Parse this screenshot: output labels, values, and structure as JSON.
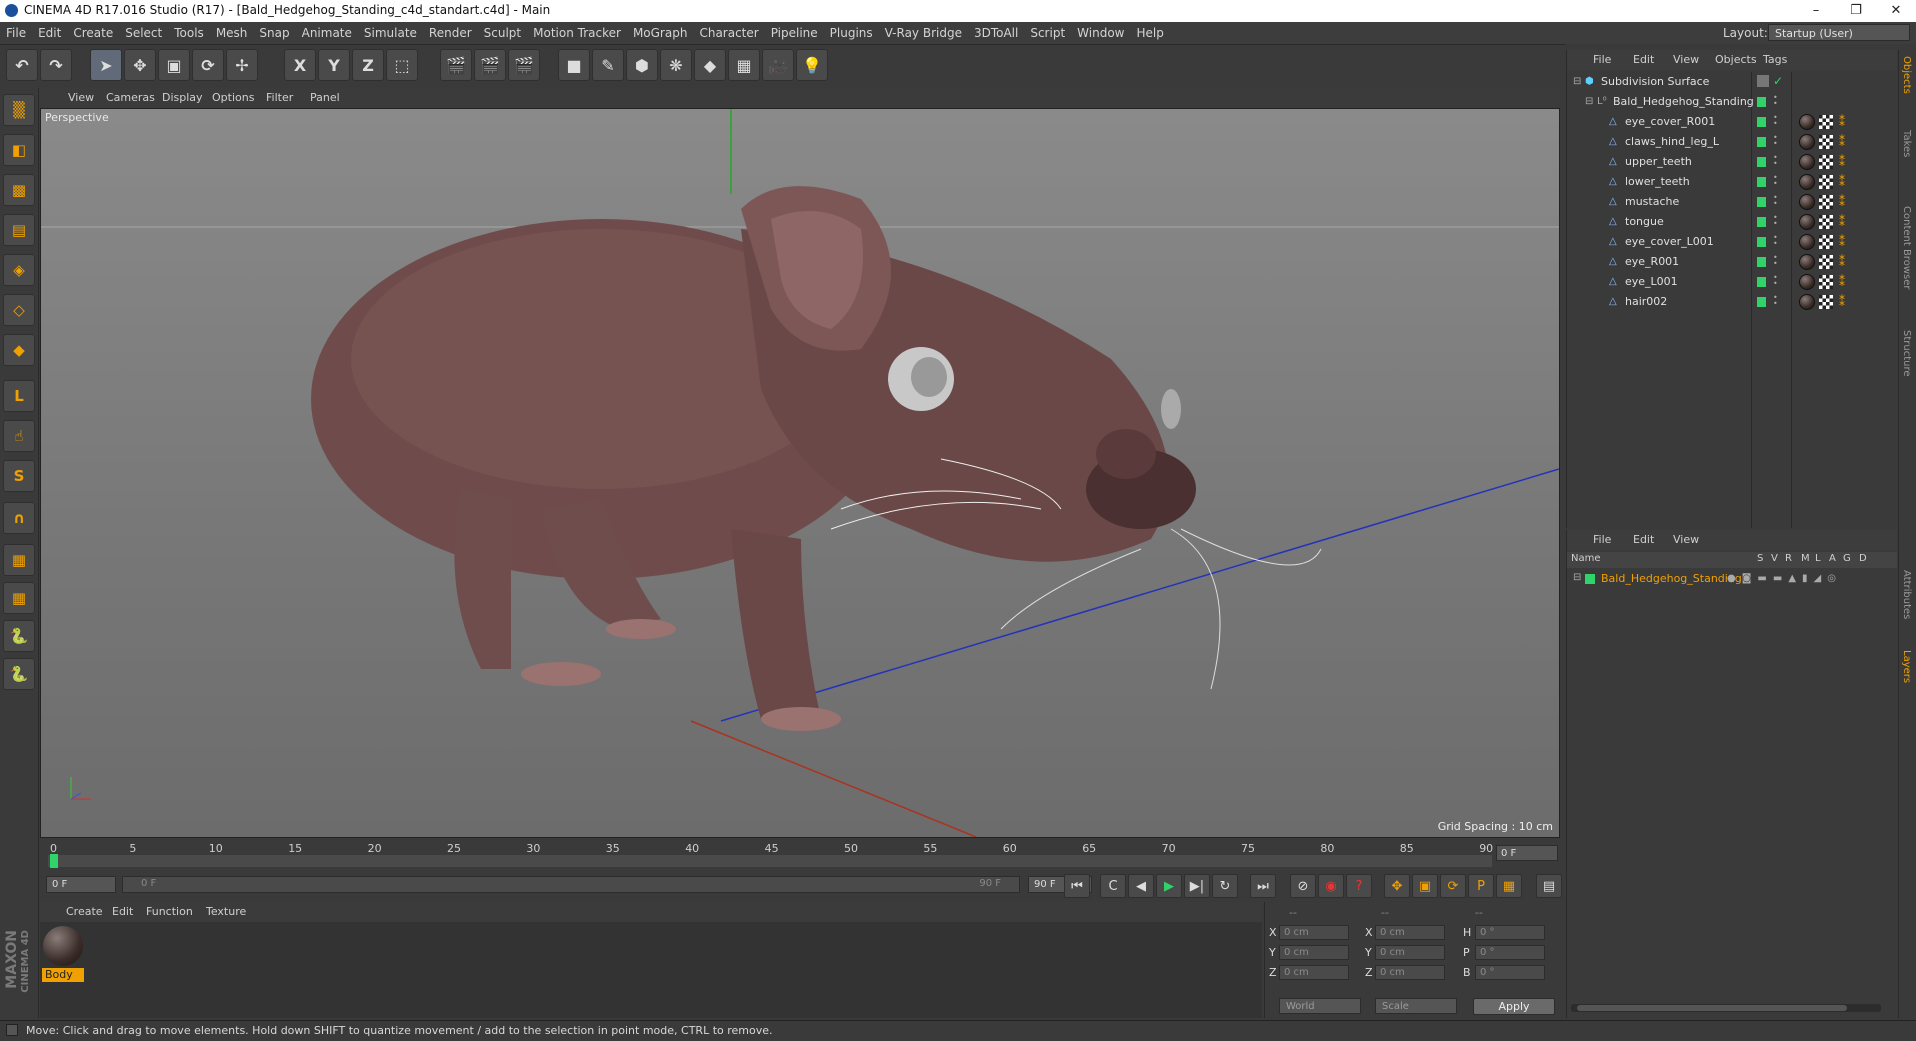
{
  "window": {
    "title": "CINEMA 4D R17.016 Studio (R17) - [Bald_Hedgehog_Standing_c4d_standart.c4d] - Main",
    "controls": [
      "–",
      "❐",
      "✕"
    ]
  },
  "menu": [
    "File",
    "Edit",
    "Create",
    "Select",
    "Tools",
    "Mesh",
    "Snap",
    "Animate",
    "Simulate",
    "Render",
    "Sculpt",
    "Motion Tracker",
    "MoGraph",
    "Character",
    "Pipeline",
    "Plugins",
    "V-Ray Bridge",
    "3DToAll",
    "Script",
    "Window",
    "Help"
  ],
  "layout": {
    "label": "Layout:",
    "value": "Startup (User)"
  },
  "toolbar": {
    "buttons": [
      {
        "name": "undo-icon",
        "glyph": "↶"
      },
      {
        "name": "redo-icon",
        "glyph": "↷"
      },
      {
        "name": "live-selection-icon",
        "glyph": "➤"
      },
      {
        "name": "move-icon",
        "glyph": "✥"
      },
      {
        "name": "scale-icon",
        "glyph": "▣"
      },
      {
        "name": "rotate-icon",
        "glyph": "⟳"
      },
      {
        "name": "transform-icon",
        "glyph": "✢"
      },
      {
        "name": "x-axis-icon",
        "glyph": "X"
      },
      {
        "name": "y-axis-icon",
        "glyph": "Y"
      },
      {
        "name": "z-axis-icon",
        "glyph": "Z"
      },
      {
        "name": "coordinate-system-icon",
        "glyph": "⬚"
      },
      {
        "name": "render-view-icon",
        "glyph": "🎬"
      },
      {
        "name": "render-picture-viewer-icon",
        "glyph": "🎬"
      },
      {
        "name": "render-settings-icon",
        "glyph": "🎬"
      },
      {
        "name": "cube-icon",
        "glyph": "■"
      },
      {
        "name": "spline-pen-icon",
        "glyph": "✎"
      },
      {
        "name": "subdivision-icon",
        "glyph": "⬢"
      },
      {
        "name": "mograph-cloner-icon",
        "glyph": "❋"
      },
      {
        "name": "deformer-icon",
        "glyph": "◆"
      },
      {
        "name": "floor-icon",
        "glyph": "▦"
      },
      {
        "name": "camera-icon",
        "glyph": "🎥"
      },
      {
        "name": "light-icon",
        "glyph": "💡"
      }
    ]
  },
  "left_tools": [
    {
      "name": "make-editable-icon",
      "glyph": "▒"
    },
    {
      "name": "model-mode-icon",
      "glyph": "◧"
    },
    {
      "name": "texture-mode-icon",
      "glyph": "▩"
    },
    {
      "name": "workplane-icon",
      "glyph": "▤"
    },
    {
      "name": "points-mode-icon",
      "glyph": "◈"
    },
    {
      "name": "edges-mode-icon",
      "glyph": "◇"
    },
    {
      "name": "polygons-mode-icon",
      "glyph": "◆"
    },
    {
      "name": "axis-icon",
      "glyph": "L"
    },
    {
      "name": "tweak-icon",
      "glyph": "☝"
    },
    {
      "name": "solo-icon",
      "glyph": "S"
    },
    {
      "name": "snap-icon",
      "glyph": "∩"
    },
    {
      "name": "lock-workplane-icon",
      "glyph": "▦"
    },
    {
      "name": "planar-workplane-icon",
      "glyph": "▦"
    },
    {
      "name": "python-icon",
      "glyph": "🐍"
    },
    {
      "name": "python-2-icon",
      "glyph": "🐍"
    }
  ],
  "viewport": {
    "menu": [
      "View",
      "Cameras",
      "Display",
      "Options",
      "Filter",
      "Panel"
    ],
    "label": "Perspective",
    "grid_spacing": "Grid Spacing : 10 cm"
  },
  "timeline": {
    "ticks": [
      "0",
      "5",
      "10",
      "15",
      "20",
      "25",
      "30",
      "35",
      "40",
      "45",
      "50",
      "55",
      "60",
      "65",
      "70",
      "75",
      "80",
      "85",
      "90"
    ],
    "current_frame": "0 F",
    "start": "0 F",
    "range_start": "0 F",
    "range_end": "90 F",
    "end": "90 F"
  },
  "transport": {
    "buttons": [
      {
        "name": "goto-start-icon",
        "glyph": "⏮"
      },
      {
        "name": "prev-key-icon",
        "glyph": "C"
      },
      {
        "name": "prev-frame-icon",
        "glyph": "◀"
      },
      {
        "name": "play-icon",
        "glyph": "▶"
      },
      {
        "name": "next-frame-icon",
        "glyph": "▶|"
      },
      {
        "name": "next-key-icon",
        "glyph": "↻"
      },
      {
        "name": "goto-end-icon",
        "glyph": "⏭"
      },
      {
        "name": "motion-record-icon",
        "glyph": "⊘"
      },
      {
        "name": "record-icon",
        "glyph": "◉"
      },
      {
        "name": "autokey-icon",
        "glyph": "?"
      },
      {
        "name": "key-position-icon",
        "glyph": "✥"
      },
      {
        "name": "key-scale-icon",
        "glyph": "▣"
      },
      {
        "name": "key-rotation-icon",
        "glyph": "⟳"
      },
      {
        "name": "key-param-icon",
        "glyph": "P"
      },
      {
        "name": "key-pla-icon",
        "glyph": "▦"
      },
      {
        "name": "timeline-icon",
        "glyph": "▤"
      }
    ]
  },
  "material_manager": {
    "menu": [
      "Create",
      "Edit",
      "Function",
      "Texture"
    ],
    "materials": [
      {
        "name": "Body"
      }
    ]
  },
  "coordinates": {
    "headers": [
      "--",
      "--",
      "--"
    ],
    "rows": [
      {
        "a": "X",
        "av": "0 cm",
        "b": "X",
        "bv": "0 cm",
        "c": "H",
        "cv": "0 °"
      },
      {
        "a": "Y",
        "av": "0 cm",
        "b": "Y",
        "bv": "0 cm",
        "c": "P",
        "cv": "0 °"
      },
      {
        "a": "Z",
        "av": "0 cm",
        "b": "Z",
        "bv": "0 cm",
        "c": "B",
        "cv": "0 °"
      }
    ],
    "mode1": "World",
    "mode2": "Scale",
    "apply": "Apply"
  },
  "object_manager": {
    "menu": [
      "File",
      "Edit",
      "View",
      "Objects",
      "Tags"
    ],
    "root": "Subdivision Surface",
    "group": "Bald_Hedgehog_Standing",
    "children": [
      "eye_cover_R001",
      "claws_hind_leg_L",
      "upper_teeth",
      "lower_teeth",
      "mustache",
      "tongue",
      "eye_cover_L001",
      "eye_R001",
      "eye_L001",
      "hair002"
    ]
  },
  "layer_manager": {
    "menu": [
      "File",
      "Edit",
      "View"
    ],
    "headers": [
      "Name",
      "S",
      "V",
      "R",
      "M",
      "L",
      "A",
      "G",
      "D"
    ],
    "layer": "Bald_Hedgehog_Standing",
    "layer_color": "#f0a000"
  },
  "side_tabs": [
    "Objects",
    "Takes",
    "Content Browser",
    "Structure",
    "Attributes",
    "Layers"
  ],
  "status": "Move: Click and drag to move elements. Hold down SHIFT to quantize movement / add to the selection in point mode, CTRL to remove.",
  "brand": {
    "line1": "MAXON",
    "line2": "CINEMA 4D"
  }
}
